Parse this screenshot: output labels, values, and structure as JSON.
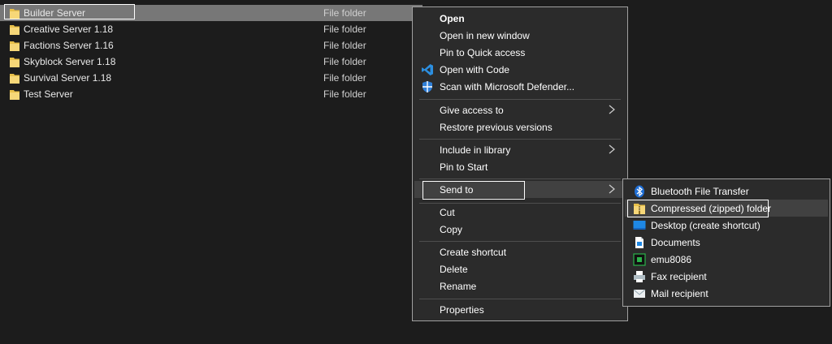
{
  "files": [
    {
      "name": "Builder Server",
      "type": "File folder"
    },
    {
      "name": "Creative Server 1.18",
      "type": "File folder"
    },
    {
      "name": "Factions Server 1.16",
      "type": "File folder"
    },
    {
      "name": "Skyblock Server 1.18",
      "type": "File folder"
    },
    {
      "name": "Survival Server 1.18",
      "type": "File folder"
    },
    {
      "name": "Test Server",
      "type": "File folder"
    }
  ],
  "context_menu": {
    "open": "Open",
    "open_new_window": "Open in new window",
    "pin_quick_access": "Pin to Quick access",
    "open_with_code": "Open with Code",
    "scan_defender": "Scan with Microsoft Defender...",
    "give_access": "Give access to",
    "restore_versions": "Restore previous versions",
    "include_library": "Include in library",
    "pin_start": "Pin to Start",
    "send_to": "Send to",
    "cut": "Cut",
    "copy": "Copy",
    "create_shortcut": "Create shortcut",
    "delete": "Delete",
    "rename": "Rename",
    "properties": "Properties"
  },
  "send_to_menu": {
    "bluetooth": "Bluetooth File Transfer",
    "compressed": "Compressed (zipped) folder",
    "desktop": "Desktop (create shortcut)",
    "documents": "Documents",
    "emu8086": "emu8086",
    "fax": "Fax recipient",
    "mail": "Mail recipient"
  },
  "colors": {
    "background": "#1c1c1c",
    "menu_bg": "#2b2b2b",
    "selection": "#777777",
    "folder": "#e8c04a",
    "bluetooth": "#1f6fd6",
    "vscode": "#2c8fe0"
  }
}
